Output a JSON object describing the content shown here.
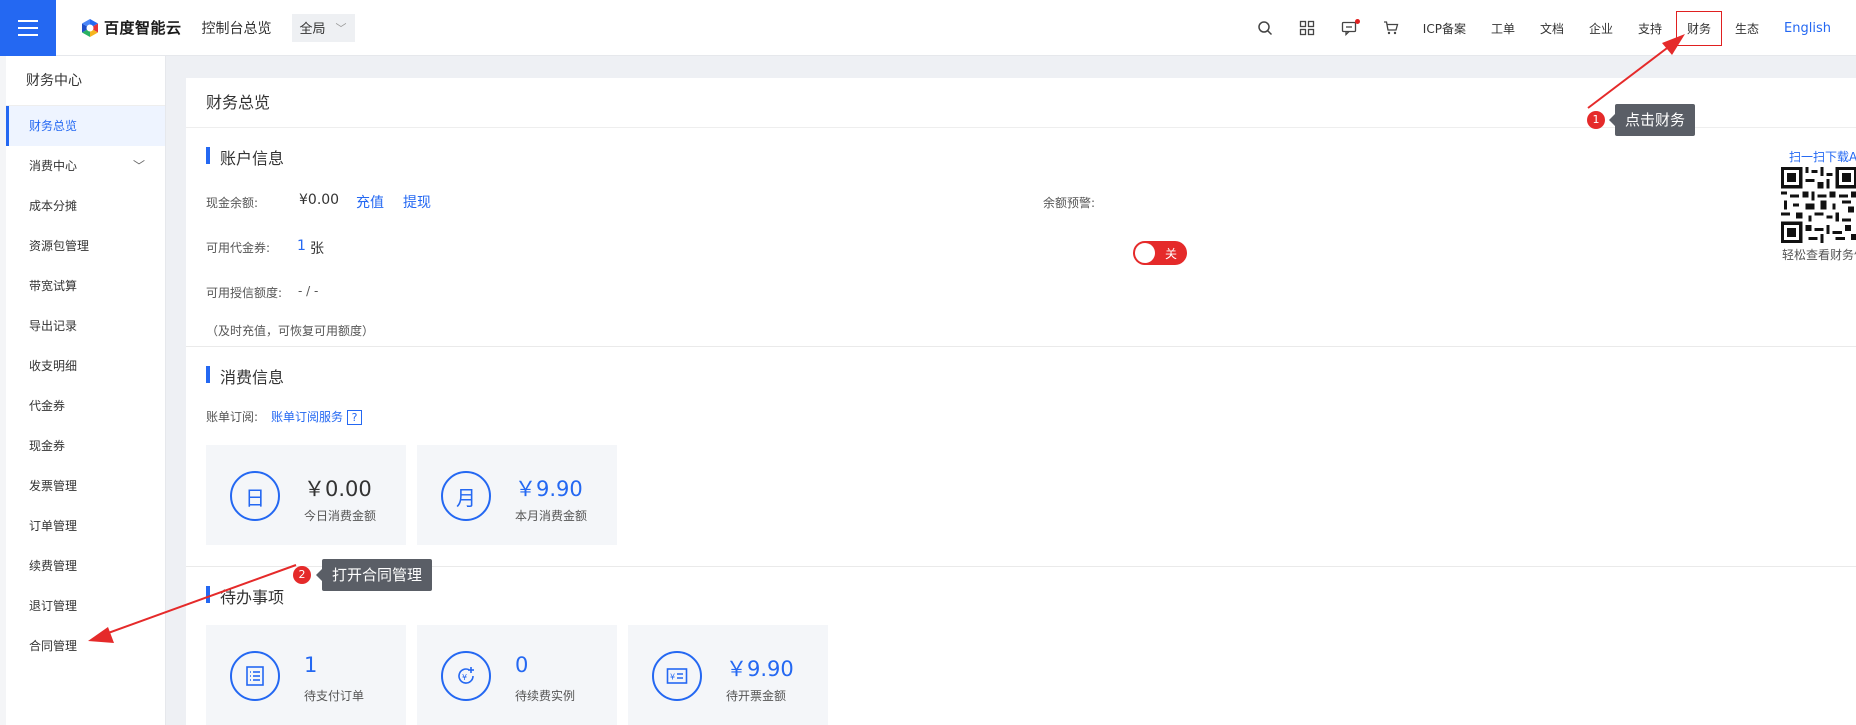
{
  "topbar": {
    "brand": "百度智能云",
    "overview": "控制台总览",
    "region": "全局",
    "links": {
      "icp": "ICP备案",
      "ticket": "工单",
      "docs": "文档",
      "enterprise": "企业",
      "support": "支持",
      "finance": "财务",
      "ecosystem": "生态",
      "english": "English"
    }
  },
  "sidebar": {
    "title": "财务中心",
    "items": [
      {
        "label": "财务总览"
      },
      {
        "label": "消费中心"
      },
      {
        "label": "成本分摊"
      },
      {
        "label": "资源包管理"
      },
      {
        "label": "带宽试算"
      },
      {
        "label": "导出记录"
      },
      {
        "label": "收支明细"
      },
      {
        "label": "代金券"
      },
      {
        "label": "现金券"
      },
      {
        "label": "发票管理"
      },
      {
        "label": "订单管理"
      },
      {
        "label": "续费管理"
      },
      {
        "label": "退订管理"
      },
      {
        "label": "合同管理"
      }
    ]
  },
  "main": {
    "page_title": "财务总览",
    "account": {
      "title": "账户信息",
      "cash_label": "现金余额:",
      "cash_value": "¥0.00",
      "recharge": "充值",
      "withdraw": "提现",
      "voucher_label": "可用代金券:",
      "voucher_count": "1",
      "voucher_unit": "张",
      "credit_label": "可用授信额度:",
      "credit_value": "- / -",
      "note": "（及时充值，可恢复可用额度）",
      "alert_label": "余额预警:",
      "alert_state": "关",
      "qr_top": "扫一扫下载A",
      "qr_bottom": "轻松查看财务信"
    },
    "consumption": {
      "title": "消费信息",
      "subscribe_label": "账单订阅:",
      "subscribe_link": "账单订阅服务",
      "help": "?",
      "cards": [
        {
          "icon": "日",
          "amount": "￥0.00",
          "label": "今日消费金额"
        },
        {
          "icon": "月",
          "amount": "￥9.90",
          "label": "本月消费金额"
        }
      ]
    },
    "todo": {
      "title": "待办事项",
      "cards": [
        {
          "amount": "1",
          "label": "待支付订单"
        },
        {
          "amount": "0",
          "label": "待续费实例"
        },
        {
          "amount": "￥9.90",
          "label": "待开票金额"
        }
      ]
    }
  },
  "annotations": {
    "step1_num": "1",
    "step1_text": "点击财务",
    "step2_num": "2",
    "step2_text": "打开合同管理"
  },
  "colors": {
    "accent": "#2468f2",
    "alert": "#e52a2a"
  }
}
